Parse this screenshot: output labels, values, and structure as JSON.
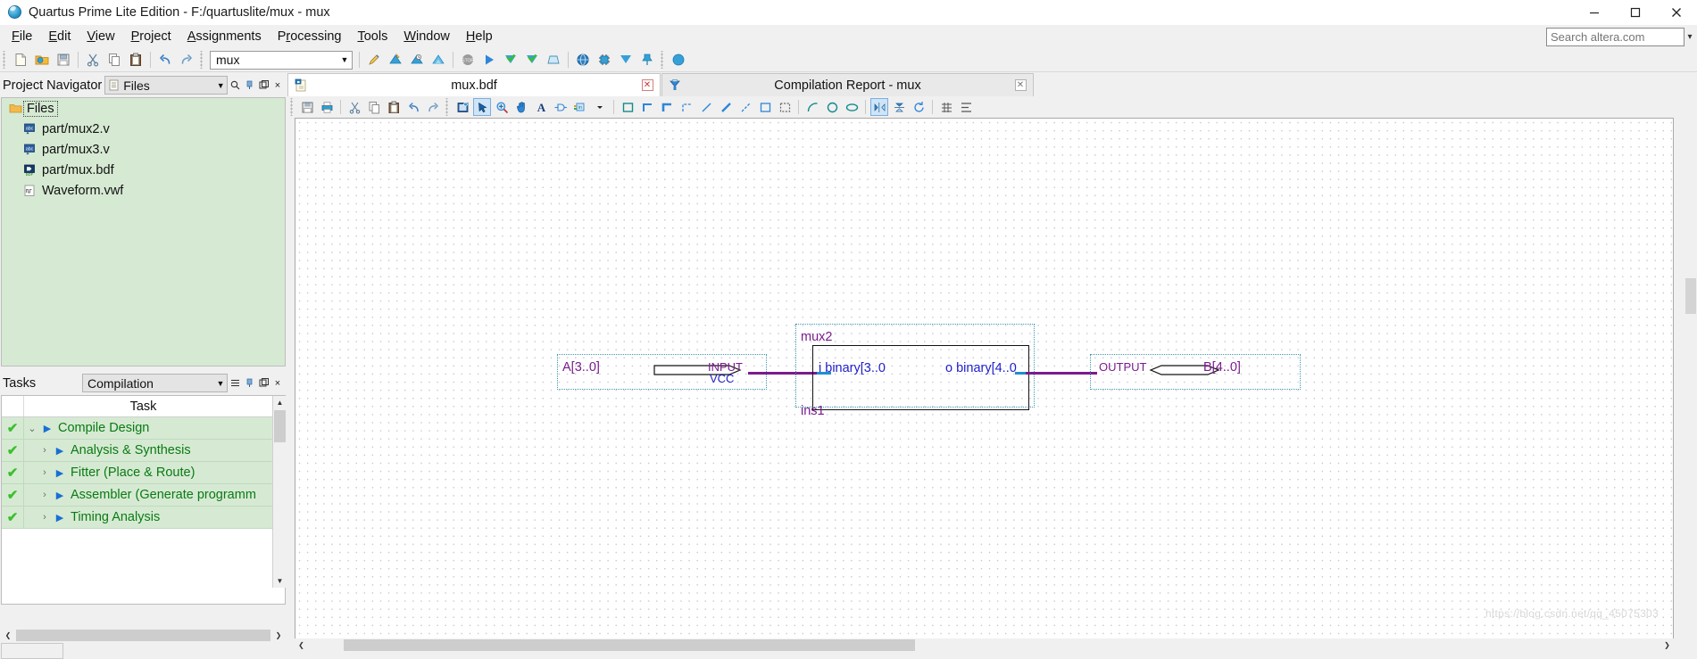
{
  "window": {
    "title": "Quartus Prime Lite Edition - F:/quartuslite/mux - mux",
    "app_icon": "quartus-globe-icon",
    "minimize": "minimize-icon",
    "maximize": "maximize-icon",
    "close": "close-icon"
  },
  "menu": {
    "items": [
      {
        "label": "File",
        "mnemonic": "F"
      },
      {
        "label": "Edit",
        "mnemonic": "E"
      },
      {
        "label": "View",
        "mnemonic": "V"
      },
      {
        "label": "Project",
        "mnemonic": "P"
      },
      {
        "label": "Assignments",
        "mnemonic": "A"
      },
      {
        "label": "Processing",
        "mnemonic": "r"
      },
      {
        "label": "Tools",
        "mnemonic": "T"
      },
      {
        "label": "Window",
        "mnemonic": "W"
      },
      {
        "label": "Help",
        "mnemonic": "H"
      }
    ],
    "search_placeholder": "Search altera.com",
    "search_value": ""
  },
  "toolbar": {
    "project_combo_value": "mux",
    "icons": [
      "new-file-icon",
      "open-file-icon",
      "save-icon",
      "cut-icon",
      "copy-icon",
      "paste-icon",
      "undo-icon",
      "redo-icon",
      "pin-planner-icon",
      "compile-design-icon",
      "analysis-synthesis-icon",
      "fitter-icon",
      "stop-icon",
      "start-compilation-icon",
      "assembler-icon",
      "timing-analysis-icon",
      "programmer-icon",
      "rtl-viewer-icon",
      "chip-planner-icon",
      "signal-tap-icon",
      "pin-icon",
      "help-icon"
    ]
  },
  "project_navigator": {
    "title": "Project Navigator",
    "combo_value": "Files",
    "combo_icon": "file-list-icon",
    "dock_buttons": [
      "search-icon",
      "pin-icon",
      "undock-icon",
      "close-icon"
    ],
    "tree": [
      {
        "label": "Files",
        "icon": "folder-icon",
        "level": 0,
        "selected": true
      },
      {
        "label": "part/mux2.v",
        "icon": "verilog-icon",
        "level": 1,
        "selected": false
      },
      {
        "label": "part/mux3.v",
        "icon": "verilog-icon",
        "level": 1,
        "selected": false
      },
      {
        "label": "part/mux.bdf",
        "icon": "bdf-icon",
        "level": 1,
        "selected": false
      },
      {
        "label": "Waveform.vwf",
        "icon": "waveform-icon",
        "level": 1,
        "selected": false
      }
    ]
  },
  "tasks": {
    "title": "Tasks",
    "combo_value": "Compilation",
    "dock_buttons": [
      "list-icon",
      "pin-icon",
      "undock-icon",
      "close-icon"
    ],
    "column_header": "Task",
    "rows": [
      {
        "label": "Compile Design",
        "status": "done",
        "level": 0,
        "expander": "expanded"
      },
      {
        "label": "Analysis & Synthesis",
        "status": "done",
        "level": 1,
        "expander": "collapsed"
      },
      {
        "label": "Fitter (Place & Route)",
        "status": "done",
        "level": 1,
        "expander": "collapsed"
      },
      {
        "label": "Assembler (Generate programm",
        "status": "done",
        "level": 1,
        "expander": "collapsed"
      },
      {
        "label": "Timing Analysis",
        "status": "done",
        "level": 1,
        "expander": "collapsed"
      }
    ],
    "status_done_glyph": "✔"
  },
  "editor": {
    "tabs": [
      {
        "label": "mux.bdf",
        "icon": "bdf-file-icon",
        "active": true,
        "close": "close-tab-icon"
      },
      {
        "label": "Compilation Report - mux",
        "icon": "report-icon",
        "active": false,
        "close": "close-tab-icon"
      }
    ],
    "schematic_toolbar": [
      "save-icon",
      "print-icon",
      "cut-icon",
      "copy-icon",
      "paste-icon",
      "undo-icon",
      "redo-icon",
      "find-icon",
      "selection-tool-icon",
      "zoom-tool-icon",
      "hand-tool-icon",
      "text-tool-icon",
      "symbol-tool-icon",
      "block-tool-icon",
      "dropdown-arrow-icon",
      "rectangle-icon",
      "orthogonal-node-line-icon",
      "orthogonal-bus-line-icon",
      "orthogonal-conduit-line-icon",
      "diagonal-node-line-icon",
      "diagonal-bus-line-icon",
      "diagonal-conduit-line-icon",
      "rubberbanding-icon",
      "partial-line-selection-icon",
      "arc-icon",
      "circle-icon",
      "oval-icon",
      "flip-horizontal-icon",
      "flip-vertical-icon",
      "rotate-icon",
      "snap-to-grid-icon",
      "align-icon"
    ]
  },
  "schematic": {
    "input_pin": {
      "signal_name": "A[3..0]",
      "type_text": "INPUT",
      "default_text": "VCC"
    },
    "block": {
      "name": "mux2",
      "instance": "ins1",
      "input_port": "i  binary[3..0",
      "output_port": "o  binary[4..0"
    },
    "output_pin": {
      "type_text": "OUTPUT",
      "signal_name": "B[4..0]"
    },
    "colors": {
      "wire": "#7a1b8c",
      "pin_text": "#7a1b8c",
      "port_text": "#1e1ec8",
      "bus_stub": "#1d8fd1"
    }
  },
  "watermark": "https://blog.csdn.net/qq_45075303"
}
